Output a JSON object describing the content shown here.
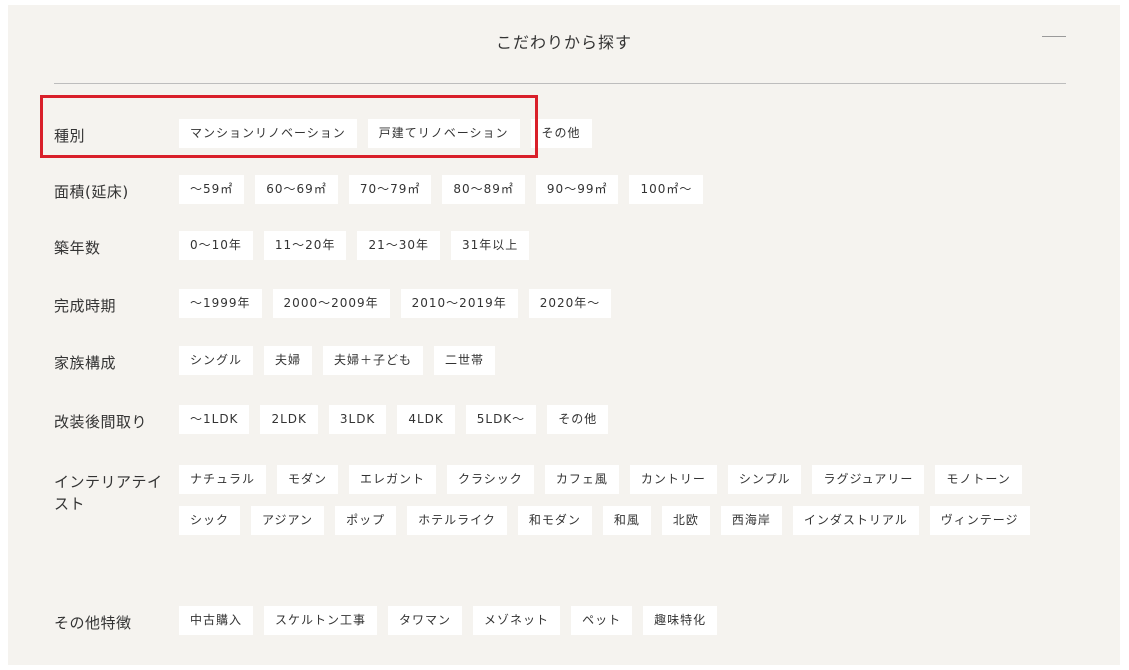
{
  "title": "こだわりから探す",
  "rows": [
    {
      "label": "種別",
      "options": [
        "マンションリノベーション",
        "戸建てリノベーション",
        "その他"
      ]
    },
    {
      "label": "面積(延床)",
      "options": [
        "〜59㎡",
        "60〜69㎡",
        "70〜79㎡",
        "80〜89㎡",
        "90〜99㎡",
        "100㎡〜"
      ]
    },
    {
      "label": "築年数",
      "options": [
        "0〜10年",
        "11〜20年",
        "21〜30年",
        "31年以上"
      ]
    },
    {
      "label": "完成時期",
      "options": [
        "〜1999年",
        "2000〜2009年",
        "2010〜2019年",
        "2020年〜"
      ]
    },
    {
      "label": "家族構成",
      "options": [
        "シングル",
        "夫婦",
        "夫婦＋子ども",
        "二世帯"
      ]
    },
    {
      "label": "改装後間取り",
      "options": [
        "〜1LDK",
        "2LDK",
        "3LDK",
        "4LDK",
        "5LDK〜",
        "その他"
      ]
    },
    {
      "label": "インテリアテイスト",
      "options": [
        "ナチュラル",
        "モダン",
        "エレガント",
        "クラシック",
        "カフェ風",
        "カントリー",
        "シンプル",
        "ラグジュアリー",
        "モノトーン",
        "シック",
        "アジアン",
        "ポップ",
        "ホテルライク",
        "和モダン",
        "和風",
        "北欧",
        "西海岸",
        "インダストリアル",
        "ヴィンテージ"
      ]
    },
    {
      "label": "その他特徴",
      "options": [
        "中古購入",
        "スケルトン工事",
        "タワマン",
        "メゾネット",
        "ペット",
        "趣味特化"
      ]
    }
  ],
  "colors": {
    "highlight": "#d9202a",
    "panel": "#f5f3ef",
    "chip": "#ffffff"
  },
  "icons": {
    "collapse": "minus-icon"
  }
}
